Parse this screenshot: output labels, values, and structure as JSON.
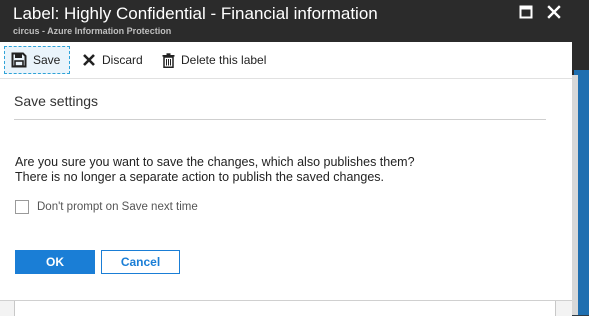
{
  "window": {
    "title": "Label: Highly Confidential - Financial information",
    "subtitle": "circus - Azure Information Protection"
  },
  "toolbar": {
    "save_label": "Save",
    "discard_label": "Discard",
    "delete_label": "Delete this label"
  },
  "dialog": {
    "title": "Save settings",
    "message_line1": "Are you sure you want to save the changes, which also publishes them?",
    "message_line2": "There is no longer a separate action to publish the saved changes.",
    "checkbox_label": "Don't prompt on Save next time",
    "checkbox_checked": false,
    "ok_label": "OK",
    "cancel_label": "Cancel"
  },
  "colors": {
    "titlebar": "#2b2b2b",
    "primary_button": "#1a7ed6",
    "save_focus_border": "#2ea3d8"
  },
  "icons": [
    "maximize-icon",
    "close-icon",
    "save-icon",
    "discard-x-icon",
    "trash-icon"
  ]
}
